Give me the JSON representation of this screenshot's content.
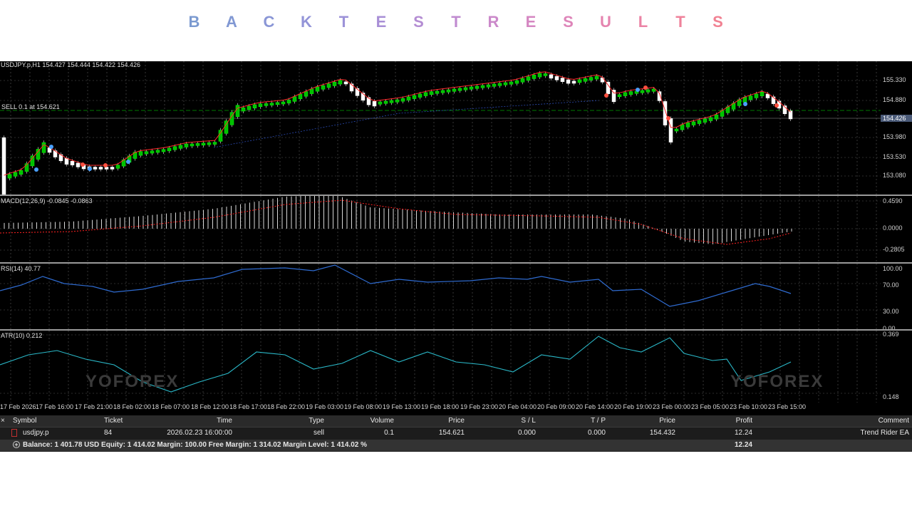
{
  "banner": {
    "letters": [
      {
        "char": "B",
        "color": "#7b9ad0"
      },
      {
        "char": "A",
        "color": "#8198d3"
      },
      {
        "char": "C",
        "color": "#8a96d6"
      },
      {
        "char": "K",
        "color": "#9394d8"
      },
      {
        "char": "T",
        "color": "#9c92d8"
      },
      {
        "char": "E",
        "color": "#a88fd6"
      },
      {
        "char": "S",
        "color": "#b48dd3"
      },
      {
        "char": "T",
        "color": "#c08bd0"
      },
      {
        "char": "R",
        "color": "#cb89ca"
      },
      {
        "char": "E",
        "color": "#d587c2"
      },
      {
        "char": "S",
        "color": "#de85b9"
      },
      {
        "char": "U",
        "color": "#e584af"
      },
      {
        "char": "L",
        "color": "#eb83a5"
      },
      {
        "char": "T",
        "color": "#ef829b"
      },
      {
        "char": "S",
        "color": "#f18192"
      }
    ]
  },
  "chart": {
    "symbol_line": "USDJPY.p,H1  154.427 154.444 154.422 154.426",
    "trade_line": "SELL 0.1 at 154.621",
    "price_scale": [
      "155.330",
      "154.880",
      "153.980",
      "153.530",
      "153.080"
    ],
    "current_price": "154.426",
    "up_color": "#00c000",
    "down_color": "#ffffff",
    "ma_color": "#ff2a2a"
  },
  "macd": {
    "label": "MACD(12,26,9) -0.0845 -0.0863",
    "scale": [
      "0.4590",
      "0.0000",
      "-0.2805"
    ]
  },
  "rsi": {
    "label": "RSI(14) 40.77",
    "scale": [
      "100.00",
      "70.00",
      "30.00",
      "0.00"
    ]
  },
  "atr": {
    "label": "ATR(10) 0.212",
    "scale": [
      "0.369",
      "0.148"
    ]
  },
  "watermark": {
    "brand": "YOFOREX"
  },
  "time_axis": [
    "17 Feb 2026",
    "17 Feb 16:00",
    "17 Feb 21:00",
    "18 Feb 02:00",
    "18 Feb 07:00",
    "18 Feb 12:00",
    "18 Feb 17:00",
    "18 Feb 22:00",
    "19 Feb 03:00",
    "19 Feb 08:00",
    "19 Feb 13:00",
    "19 Feb 18:00",
    "19 Feb 23:00",
    "20 Feb 04:00",
    "20 Feb 09:00",
    "20 Feb 14:00",
    "20 Feb 19:00",
    "23 Feb 00:00",
    "23 Feb 05:00",
    "23 Feb 10:00",
    "23 Feb 15:00"
  ],
  "trades": {
    "close_icon": "×",
    "headers": {
      "symbol": "Symbol",
      "ticket": "Ticket",
      "time": "Time",
      "type": "Type",
      "volume": "Volume",
      "price": "Price",
      "sl": "S / L",
      "tp": "T / P",
      "price2": "Price",
      "profit": "Profit",
      "comment": "Comment"
    },
    "row": {
      "symbol": "usdjpy.p",
      "ticket": "84",
      "time": "2026.02.23 16:00:00",
      "type": "sell",
      "volume": "0.1",
      "price": "154.621",
      "sl": "0.000",
      "tp": "0.000",
      "price2": "154.432",
      "profit": "12.24",
      "comment": "Trend Rider EA"
    },
    "summary": {
      "text": "Balance: 1 401.78 USD  Equity: 1 414.02  Margin: 100.00  Free Margin: 1 314.02  Margin Level: 1 414.02 %",
      "profit": "12.24"
    }
  }
}
